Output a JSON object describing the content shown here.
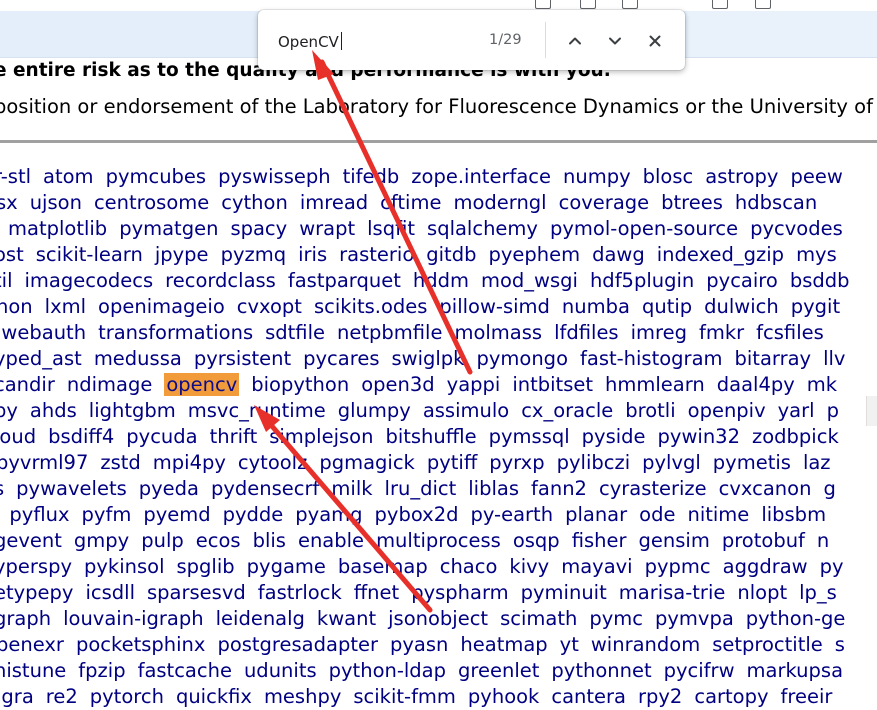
{
  "find_bar": {
    "query": "OpenCV",
    "match_count": "1/29"
  },
  "page": {
    "disclaimer_bold": "e entire risk as to the quality and performance is with you.",
    "disclaimer_normal": "position or endorsement of the Laboratory for Fluorescence Dynamics or the University of Ca",
    "highlighted_package": "opencv",
    "package_rows": [
      [
        "r-stl",
        "atom",
        "pymcubes",
        "pyswisseph",
        "tifedb",
        "zope.interface",
        "numpy",
        "blosc",
        "astropy",
        "peew"
      ],
      [
        "sx",
        "ujson",
        "centrosome",
        "cython",
        "imread",
        "cftime",
        "moderngl",
        "coverage",
        "btrees",
        "hdbscan"
      ],
      [
        "matplotlib",
        "pymatgen",
        "spacy",
        "wrapt",
        "lsqfit",
        "sqlalchemy",
        "pymol-open-source",
        "pycvodes"
      ],
      [
        "ost",
        "scikit-learn",
        "jpype",
        "pyzmq",
        "iris",
        "rasterio",
        "gitdb",
        "pyephem",
        "dawg",
        "indexed_gzip",
        "mys"
      ],
      [
        "til",
        "imagecodecs",
        "recordclass",
        "fastparquet",
        "hddm",
        "mod_wsgi",
        "hdf5plugin",
        "pycairo",
        "bsddb"
      ],
      [
        "hon",
        "lxml",
        "openimageio",
        "cvxopt",
        "scikits.odes",
        "pillow-simd",
        "numba",
        "qutip",
        "dulwich",
        "pygit"
      ],
      [
        "iwebauth",
        "transformations",
        "sdtfile",
        "netpbmfile",
        "molmass",
        "lfdfiles",
        "imreg",
        "fmkr",
        "fcsfiles"
      ],
      [
        "yped_ast",
        "medussa",
        "pyrsistent",
        "pycares",
        "swiglpk",
        "pymongo",
        "fast-histogram",
        "bitarray",
        "llv"
      ],
      [
        "candir",
        "ndimage",
        "opencv",
        "biopython",
        "open3d",
        "yappi",
        "intbitset",
        "hmmlearn",
        "daal4py",
        "mk"
      ],
      [
        "py",
        "ahds",
        "lightgbm",
        "msvc_runtime",
        "glumpy",
        "assimulo",
        "cx_oracle",
        "brotli",
        "openpiv",
        "yarl",
        "p"
      ],
      [
        "loud",
        "bsdiff4",
        "pycuda",
        "thrift",
        "simplejson",
        "bitshuffle",
        "pymssql",
        "pyside",
        "pywin32",
        "zodbpick"
      ],
      [
        "pyvrml97",
        "zstd",
        "mpi4py",
        "cytoolz",
        "pgmagick",
        "pytiff",
        "pyrxp",
        "pylibczi",
        "pylvgl",
        "pymetis",
        "laz"
      ],
      [
        "s",
        "pywavelets",
        "pyeda",
        "pydensecrf",
        "milk",
        "lru_dict",
        "liblas",
        "fann2",
        "cyrasterize",
        "cvxcanon",
        "g"
      ],
      [
        "i",
        "pyflux",
        "pyfm",
        "pyemd",
        "pydde",
        "pyamg",
        "pybox2d",
        "py-earth",
        "planar",
        "ode",
        "nitime",
        "libsbm"
      ],
      [
        "gevent",
        "gmpy",
        "pulp",
        "ecos",
        "blis",
        "enable",
        "multiprocess",
        "osqp",
        "fisher",
        "gensim",
        "protobuf",
        "n"
      ],
      [
        "yperspy",
        "pykinsol",
        "spglib",
        "pygame",
        "basemap",
        "chaco",
        "kivy",
        "mayavi",
        "pypmc",
        "aggdraw",
        "py"
      ],
      [
        "etypepy",
        "icsdll",
        "sparsesvd",
        "fastrlock",
        "ffnet",
        "pyspharm",
        "pyminuit",
        "marisa-trie",
        "nlopt",
        "lp_s"
      ],
      [
        "graph",
        "louvain-igraph",
        "leidenalg",
        "kwant",
        "jsonobject",
        "scimath",
        "pymc",
        "pymvpa",
        "python-ge"
      ],
      [
        "penexr",
        "pocketsphinx",
        "postgresadapter",
        "pyasn",
        "heatmap",
        "yt",
        "winrandom",
        "setproctitle",
        "s"
      ],
      [
        "histune",
        "fpzip",
        "fastcache",
        "udunits",
        "python-ldap",
        "greenlet",
        "pythonnet",
        "pycifrw",
        "markupsa"
      ],
      [
        "igra",
        "re2",
        "pytorch",
        "quickfix",
        "meshpy",
        "scikit-fmm",
        "pyhook",
        "cantera",
        "rpy2",
        "cartopy",
        "freeir"
      ]
    ]
  },
  "colors": {
    "link": "#000080",
    "highlight": "#f29b3a",
    "annotation_arrow": "#e8302a",
    "bookmark_bar": "#e3eefa"
  },
  "icons": [
    "chevron-up-icon",
    "chevron-down-icon",
    "close-icon",
    "arrow-annotation"
  ]
}
